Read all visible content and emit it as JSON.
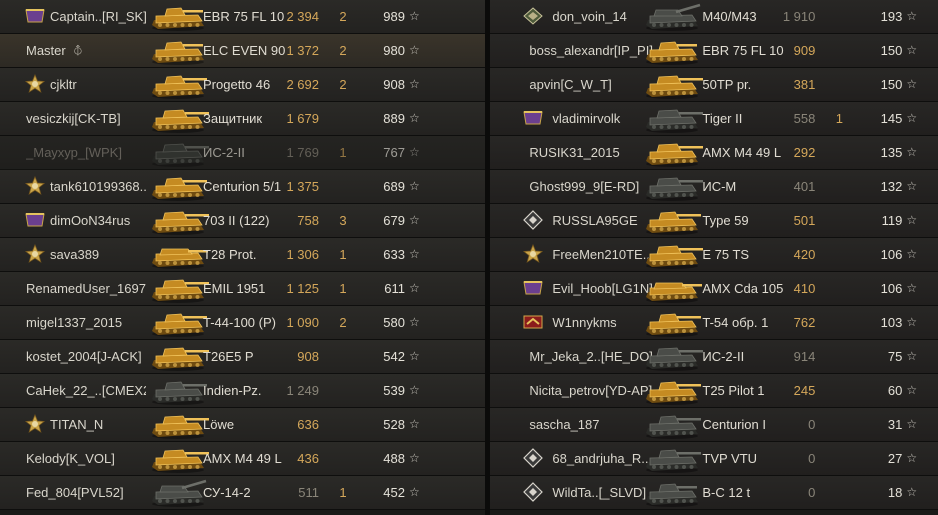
{
  "colors": {
    "gold": "#d4a75a",
    "text": "#d9d6cc",
    "dead": "#8a857c",
    "bg": "#2b2a27"
  },
  "left_team": [
    {
      "badge": "rank-35",
      "player": "Captain..[RI_SK]",
      "tank": "EBR 75 FL 10",
      "damage": "2 394",
      "kills": "2",
      "xp": "989",
      "tank_icon": "light-tank",
      "state": "gold"
    },
    {
      "badge": "none",
      "player": "Master",
      "tank": "ELC EVEN 90",
      "damage": "1 372",
      "kills": "2",
      "xp": "980",
      "tank_icon": "light-tank",
      "state": "gold",
      "self": true
    },
    {
      "badge": "star-medal",
      "player": "cjkltr",
      "tank": "Progetto 46",
      "damage": "2 692",
      "kills": "2",
      "xp": "908",
      "tank_icon": "medium-tank",
      "state": "gold"
    },
    {
      "badge": "none",
      "player": "vesiczkij[CK-TB]",
      "tank": "Защитник",
      "damage": "1 679",
      "kills": "",
      "xp": "889",
      "tank_icon": "heavy-tank",
      "state": "gold"
    },
    {
      "badge": "none",
      "player": "_Маухур_[WPK]",
      "tank": "ИС-2-II",
      "damage": "1 769",
      "kills": "1",
      "xp": "767",
      "tank_icon": "heavy-tank",
      "state": "dead"
    },
    {
      "badge": "star-medal",
      "player": "tank610199368..",
      "tank": "Centurion 5/1",
      "damage": "1 375",
      "kills": "",
      "xp": "689",
      "tank_icon": "medium-tank",
      "state": "gold"
    },
    {
      "badge": "rank-15",
      "player": "dimOoN34rus",
      "tank": "703 II (122)",
      "damage": "758",
      "kills": "3",
      "xp": "679",
      "tank_icon": "heavy-tank",
      "state": "gold"
    },
    {
      "badge": "star-medal",
      "player": "sava389",
      "tank": "T28 Prot.",
      "damage": "1 306",
      "kills": "1",
      "xp": "633",
      "tank_icon": "td-tank",
      "state": "gold"
    },
    {
      "badge": "none",
      "player": "RenamedUser_1697..",
      "tank": "EMIL 1951",
      "damage": "1 125",
      "kills": "1",
      "xp": "611",
      "tank_icon": "heavy-tank",
      "state": "gold"
    },
    {
      "badge": "none",
      "player": "migel1337_2015",
      "tank": "T-44-100 (P)",
      "damage": "1 090",
      "kills": "2",
      "xp": "580",
      "tank_icon": "medium-tank",
      "state": "gold"
    },
    {
      "badge": "none",
      "player": "kostet_2004[J-ACK]",
      "tank": "T26E5 P",
      "damage": "908",
      "kills": "",
      "xp": "542",
      "tank_icon": "heavy-tank",
      "state": "gold"
    },
    {
      "badge": "none",
      "player": "CaHek_22_..[CMEX2]",
      "tank": "Indien-Pz.",
      "damage": "1 249",
      "kills": "",
      "xp": "539",
      "tank_icon": "medium-tank",
      "state": "grey"
    },
    {
      "badge": "star-medal",
      "player": "TITAN_N",
      "tank": "Löwe",
      "damage": "636",
      "kills": "",
      "xp": "528",
      "tank_icon": "heavy-tank",
      "state": "gold"
    },
    {
      "badge": "none",
      "player": "Kelody[K_VOL]",
      "tank": "AMX M4 49 L",
      "damage": "436",
      "kills": "",
      "xp": "488",
      "tank_icon": "heavy-tank",
      "state": "gold"
    },
    {
      "badge": "none",
      "player": "Fed_804[PVL52]",
      "tank": "СУ-14-2",
      "damage": "511",
      "kills": "1",
      "xp": "452",
      "tank_icon": "spg-tank",
      "state": "grey"
    }
  ],
  "right_team": [
    {
      "badge": "tier-emblem",
      "player": "don_voin_14",
      "tank": "M40/M43",
      "damage": "1 910",
      "kills": "",
      "xp": "193",
      "tank_icon": "spg-tank",
      "state": "grey"
    },
    {
      "badge": "none",
      "player": "boss_alexandr[IP_PI]",
      "tank": "EBR 75 FL 10",
      "damage": "909",
      "kills": "",
      "xp": "150",
      "tank_icon": "light-tank",
      "state": "gold"
    },
    {
      "badge": "none",
      "player": "apvin[C_W_T]",
      "tank": "50TP pr.",
      "damage": "381",
      "kills": "",
      "xp": "150",
      "tank_icon": "heavy-tank",
      "state": "gold"
    },
    {
      "badge": "rank-4",
      "player": "vladimirvolk",
      "tank": "Tiger II",
      "damage": "558",
      "kills": "1",
      "xp": "145",
      "tank_icon": "heavy-tank",
      "state": "grey"
    },
    {
      "badge": "none",
      "player": "RUSIK31_2015",
      "tank": "AMX M4 49 L",
      "damage": "292",
      "kills": "",
      "xp": "135",
      "tank_icon": "heavy-tank",
      "state": "gold"
    },
    {
      "badge": "none",
      "player": "Ghost999_9[E-RD]",
      "tank": "ИС-М",
      "damage": "401",
      "kills": "",
      "xp": "132",
      "tank_icon": "heavy-tank",
      "state": "grey"
    },
    {
      "badge": "diamond-emblem",
      "player": "RUSSLA95GE",
      "tank": "Type 59",
      "damage": "501",
      "kills": "",
      "xp": "119",
      "tank_icon": "medium-tank",
      "state": "gold"
    },
    {
      "badge": "star-medal",
      "player": "FreeMen210TE..",
      "tank": "E 75 TS",
      "damage": "420",
      "kills": "",
      "xp": "106",
      "tank_icon": "heavy-tank",
      "state": "gold"
    },
    {
      "badge": "rank-55",
      "player": "Evil_Hoob[LG1N]",
      "tank": "AMX Cda 105",
      "damage": "410",
      "kills": "",
      "xp": "106",
      "tank_icon": "td-tank",
      "state": "gold"
    },
    {
      "badge": "chevron-medal",
      "player": "W1nnykms",
      "tank": "T-54 обр. 1",
      "damage": "762",
      "kills": "",
      "xp": "103",
      "tank_icon": "medium-tank",
      "state": "gold"
    },
    {
      "badge": "none",
      "player": "Mr_Jeka_2..[HE_DO]",
      "tank": "ИС-2-II",
      "damage": "914",
      "kills": "",
      "xp": "75",
      "tank_icon": "heavy-tank",
      "state": "grey"
    },
    {
      "badge": "none",
      "player": "Nicita_petrov[YD-AP]",
      "tank": "T25 Pilot 1",
      "damage": "245",
      "kills": "",
      "xp": "60",
      "tank_icon": "medium-tank",
      "state": "gold"
    },
    {
      "badge": "none",
      "player": "sascha_187",
      "tank": "Centurion I",
      "damage": "0",
      "kills": "",
      "xp": "31",
      "tank_icon": "medium-tank",
      "state": "grey"
    },
    {
      "badge": "diamond-emblem",
      "player": "68_andrjuha_R..",
      "tank": "TVP VTU",
      "damage": "0",
      "kills": "",
      "xp": "27",
      "tank_icon": "medium-tank",
      "state": "grey"
    },
    {
      "badge": "diamond-emblem",
      "player": "WildTa..[_SLVD]",
      "tank": "B-C 12 t",
      "damage": "0",
      "kills": "",
      "xp": "18",
      "tank_icon": "light-tank",
      "state": "grey"
    }
  ]
}
